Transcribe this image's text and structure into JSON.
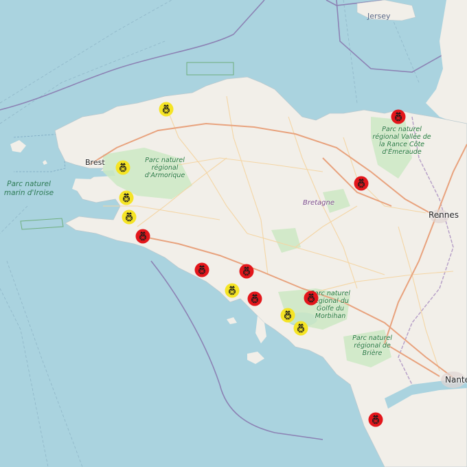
{
  "map": {
    "colors": {
      "sea": "#aad3df",
      "land": "#f2efe9",
      "park": "#cde9c4",
      "road_major": "#e8a27d",
      "road_primary": "#f2c98f",
      "boundary": "#9b8fb3",
      "marker_red": "#e3161b",
      "marker_yellow": "#f5e425"
    },
    "labels": {
      "jersey": "Jersey",
      "brest": "Brest",
      "rennes": "Rennes",
      "nantes": "Nante",
      "bretagne": "Bretagne",
      "parc_iroise": "Parc naturel marin d'Iroise",
      "parc_armorique": "Parc naturel régional d'Armorique",
      "parc_rance": "Parc naturel régional Vallée de la Rance Côte d'Émeraude",
      "parc_morbihan": "Parc naturel régional du Golfe du Morbihan",
      "parc_briere": "Parc naturel régional de Brière"
    },
    "markers": [
      {
        "id": "m1",
        "color": "yellow"
      },
      {
        "id": "m2",
        "color": "red"
      },
      {
        "id": "m3",
        "color": "yellow"
      },
      {
        "id": "m4",
        "color": "red"
      },
      {
        "id": "m5",
        "color": "yellow"
      },
      {
        "id": "m6",
        "color": "yellow"
      },
      {
        "id": "m7",
        "color": "red"
      },
      {
        "id": "m8",
        "color": "red"
      },
      {
        "id": "m9",
        "color": "red"
      },
      {
        "id": "m10",
        "color": "yellow"
      },
      {
        "id": "m11",
        "color": "red"
      },
      {
        "id": "m12",
        "color": "red"
      },
      {
        "id": "m13",
        "color": "yellow"
      },
      {
        "id": "m14",
        "color": "yellow"
      },
      {
        "id": "m15",
        "color": "red"
      }
    ],
    "icons": {
      "marker_emblem": "pineapple-emblem-icon"
    }
  }
}
